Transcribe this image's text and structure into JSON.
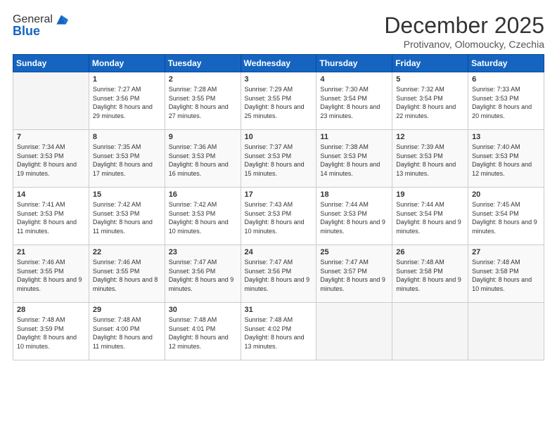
{
  "header": {
    "logo_general": "General",
    "logo_blue": "Blue",
    "month": "December 2025",
    "location": "Protivanov, Olomoucky, Czechia"
  },
  "weekdays": [
    "Sunday",
    "Monday",
    "Tuesday",
    "Wednesday",
    "Thursday",
    "Friday",
    "Saturday"
  ],
  "weeks": [
    [
      {
        "day": "",
        "sunrise": "",
        "sunset": "",
        "daylight": ""
      },
      {
        "day": "1",
        "sunrise": "7:27 AM",
        "sunset": "3:56 PM",
        "daylight": "8 hours and 29 minutes."
      },
      {
        "day": "2",
        "sunrise": "7:28 AM",
        "sunset": "3:55 PM",
        "daylight": "8 hours and 27 minutes."
      },
      {
        "day": "3",
        "sunrise": "7:29 AM",
        "sunset": "3:55 PM",
        "daylight": "8 hours and 25 minutes."
      },
      {
        "day": "4",
        "sunrise": "7:30 AM",
        "sunset": "3:54 PM",
        "daylight": "8 hours and 23 minutes."
      },
      {
        "day": "5",
        "sunrise": "7:32 AM",
        "sunset": "3:54 PM",
        "daylight": "8 hours and 22 minutes."
      },
      {
        "day": "6",
        "sunrise": "7:33 AM",
        "sunset": "3:53 PM",
        "daylight": "8 hours and 20 minutes."
      }
    ],
    [
      {
        "day": "7",
        "sunrise": "7:34 AM",
        "sunset": "3:53 PM",
        "daylight": "8 hours and 19 minutes."
      },
      {
        "day": "8",
        "sunrise": "7:35 AM",
        "sunset": "3:53 PM",
        "daylight": "8 hours and 17 minutes."
      },
      {
        "day": "9",
        "sunrise": "7:36 AM",
        "sunset": "3:53 PM",
        "daylight": "8 hours and 16 minutes."
      },
      {
        "day": "10",
        "sunrise": "7:37 AM",
        "sunset": "3:53 PM",
        "daylight": "8 hours and 15 minutes."
      },
      {
        "day": "11",
        "sunrise": "7:38 AM",
        "sunset": "3:53 PM",
        "daylight": "8 hours and 14 minutes."
      },
      {
        "day": "12",
        "sunrise": "7:39 AM",
        "sunset": "3:53 PM",
        "daylight": "8 hours and 13 minutes."
      },
      {
        "day": "13",
        "sunrise": "7:40 AM",
        "sunset": "3:53 PM",
        "daylight": "8 hours and 12 minutes."
      }
    ],
    [
      {
        "day": "14",
        "sunrise": "7:41 AM",
        "sunset": "3:53 PM",
        "daylight": "8 hours and 11 minutes."
      },
      {
        "day": "15",
        "sunrise": "7:42 AM",
        "sunset": "3:53 PM",
        "daylight": "8 hours and 11 minutes."
      },
      {
        "day": "16",
        "sunrise": "7:42 AM",
        "sunset": "3:53 PM",
        "daylight": "8 hours and 10 minutes."
      },
      {
        "day": "17",
        "sunrise": "7:43 AM",
        "sunset": "3:53 PM",
        "daylight": "8 hours and 10 minutes."
      },
      {
        "day": "18",
        "sunrise": "7:44 AM",
        "sunset": "3:53 PM",
        "daylight": "8 hours and 9 minutes."
      },
      {
        "day": "19",
        "sunrise": "7:44 AM",
        "sunset": "3:54 PM",
        "daylight": "8 hours and 9 minutes."
      },
      {
        "day": "20",
        "sunrise": "7:45 AM",
        "sunset": "3:54 PM",
        "daylight": "8 hours and 9 minutes."
      }
    ],
    [
      {
        "day": "21",
        "sunrise": "7:46 AM",
        "sunset": "3:55 PM",
        "daylight": "8 hours and 9 minutes."
      },
      {
        "day": "22",
        "sunrise": "7:46 AM",
        "sunset": "3:55 PM",
        "daylight": "8 hours and 8 minutes."
      },
      {
        "day": "23",
        "sunrise": "7:47 AM",
        "sunset": "3:56 PM",
        "daylight": "8 hours and 9 minutes."
      },
      {
        "day": "24",
        "sunrise": "7:47 AM",
        "sunset": "3:56 PM",
        "daylight": "8 hours and 9 minutes."
      },
      {
        "day": "25",
        "sunrise": "7:47 AM",
        "sunset": "3:57 PM",
        "daylight": "8 hours and 9 minutes."
      },
      {
        "day": "26",
        "sunrise": "7:48 AM",
        "sunset": "3:58 PM",
        "daylight": "8 hours and 9 minutes."
      },
      {
        "day": "27",
        "sunrise": "7:48 AM",
        "sunset": "3:58 PM",
        "daylight": "8 hours and 10 minutes."
      }
    ],
    [
      {
        "day": "28",
        "sunrise": "7:48 AM",
        "sunset": "3:59 PM",
        "daylight": "8 hours and 10 minutes."
      },
      {
        "day": "29",
        "sunrise": "7:48 AM",
        "sunset": "4:00 PM",
        "daylight": "8 hours and 11 minutes."
      },
      {
        "day": "30",
        "sunrise": "7:48 AM",
        "sunset": "4:01 PM",
        "daylight": "8 hours and 12 minutes."
      },
      {
        "day": "31",
        "sunrise": "7:48 AM",
        "sunset": "4:02 PM",
        "daylight": "8 hours and 13 minutes."
      },
      {
        "day": "",
        "sunrise": "",
        "sunset": "",
        "daylight": ""
      },
      {
        "day": "",
        "sunrise": "",
        "sunset": "",
        "daylight": ""
      },
      {
        "day": "",
        "sunrise": "",
        "sunset": "",
        "daylight": ""
      }
    ]
  ]
}
